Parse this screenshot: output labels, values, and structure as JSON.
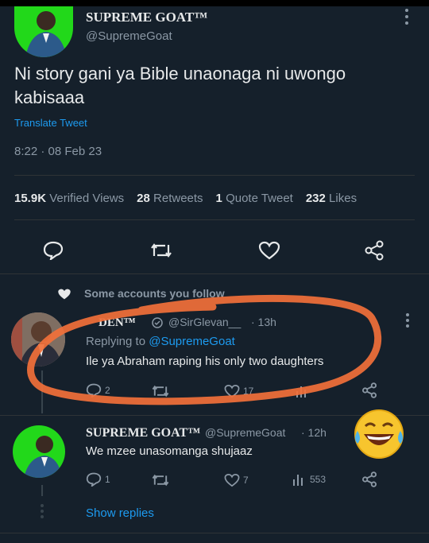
{
  "main_tweet": {
    "display_name": "SUPREME GOAT™",
    "handle": "@SupremeGoat",
    "text_line1": "Ni story gani ya Bible unaonaga ni uwongo",
    "text_line2": "kabisaaa",
    "translate": "Translate Tweet",
    "timestamp": "8:22 · 08 Feb 23",
    "stats": {
      "views_count": "15.9K",
      "views_label": "Verified Views",
      "retweets_count": "28",
      "retweets_label": "Retweets",
      "quotes_count": "1",
      "quotes_label": "Quote Tweet",
      "likes_count": "232",
      "likes_label": "Likes"
    }
  },
  "social_context": "Some accounts you follow",
  "reply1": {
    "display_name": "DEN™",
    "handle": "@SirGlevan__",
    "time": "· 13h",
    "replying_prefix": "Replying to",
    "replying_to": "@SupremeGoat",
    "text": "Ile ya Abraham raping his only two daughters",
    "reply_count": "2",
    "like_count": "17"
  },
  "reply2": {
    "display_name": "SUPREME GOAT™",
    "handle": "@SupremeGoat",
    "time": "· 12h",
    "text": "We mzee unasomanga shujaaz",
    "reply_count": "1",
    "like_count": "7",
    "view_count": "553"
  },
  "show_replies": "Show replies",
  "colors": {
    "background": "#15202b",
    "accent": "#1d9bf0",
    "annotation": "#f2703a",
    "avatar_green": "#22d81a"
  }
}
